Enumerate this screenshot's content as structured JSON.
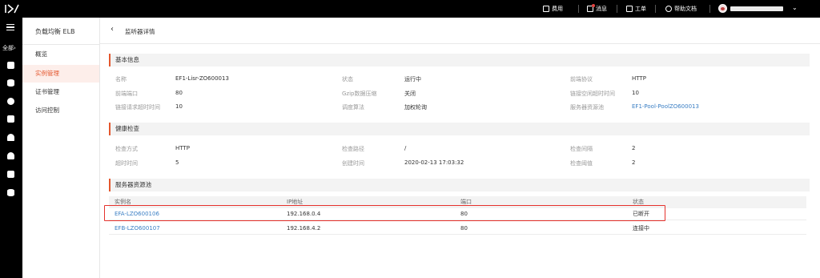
{
  "topbar": {
    "items": [
      {
        "label": "费用",
        "icon": "billing-icon"
      },
      {
        "label": "消息",
        "icon": "message-icon"
      },
      {
        "label": "工单",
        "icon": "ticket-icon"
      },
      {
        "label": "帮助文档",
        "icon": "help-icon"
      }
    ]
  },
  "rail": {
    "all_label": "全部",
    "all_arrow": "›",
    "icons": [
      "home-icon",
      "database-icon",
      "globe-icon",
      "storage-icon",
      "cloud-upload-icon",
      "cloud-icon",
      "close-box-icon",
      "stack-icon"
    ]
  },
  "sidenav": {
    "title": "负载均衡 ELB",
    "items": [
      {
        "label": "概览",
        "active": false
      },
      {
        "label": "实例管理",
        "active": true
      },
      {
        "label": "证书管理",
        "active": false
      },
      {
        "label": "访问控制",
        "active": false
      }
    ]
  },
  "main": {
    "back_glyph": "‹",
    "title": "监听器详情"
  },
  "basic": {
    "title": "基本信息",
    "fields": [
      {
        "label": "名称",
        "value": "EF1-Lisr-ZO600013"
      },
      {
        "label": "状态",
        "value": "运行中"
      },
      {
        "label": "前端协议",
        "value": "HTTP"
      },
      {
        "label": "前端端口",
        "value": "80"
      },
      {
        "label": "Gzip数据压缩",
        "value": "关闭"
      },
      {
        "label": "链接空闲超时时间",
        "value": "10"
      },
      {
        "label": "链接请求超时时间",
        "value": "10"
      },
      {
        "label": "调度算法",
        "value": "加权轮询"
      },
      {
        "label": "服务器资源池",
        "value": "EF1-Pool-PoolZO600013"
      }
    ]
  },
  "health": {
    "title": "健康检查",
    "fields": [
      {
        "label": "检查方式",
        "value": "HTTP"
      },
      {
        "label": "检查路径",
        "value": "/"
      },
      {
        "label": "检查间隔",
        "value": "2"
      },
      {
        "label": "超时时间",
        "value": "5"
      },
      {
        "label": "创建时间",
        "value": "2020-02-13 17:03:32"
      },
      {
        "label": "检查阈值",
        "value": "2"
      }
    ]
  },
  "pool": {
    "title": "服务器资源池",
    "columns": [
      "实例名",
      "IP地址",
      "端口",
      "状态"
    ],
    "rows": [
      {
        "name": "EFA-LZO600106",
        "ip": "192.168.0.4",
        "port": "80",
        "status": "已断开"
      },
      {
        "name": "EFB-LZO600107",
        "ip": "192.168.4.2",
        "port": "80",
        "status": "连接中"
      }
    ]
  },
  "colors": {
    "accent": "#e4572e",
    "link": "#3b7fc4",
    "highlight_border": "#e5322d",
    "topbar_bg": "#000000"
  }
}
